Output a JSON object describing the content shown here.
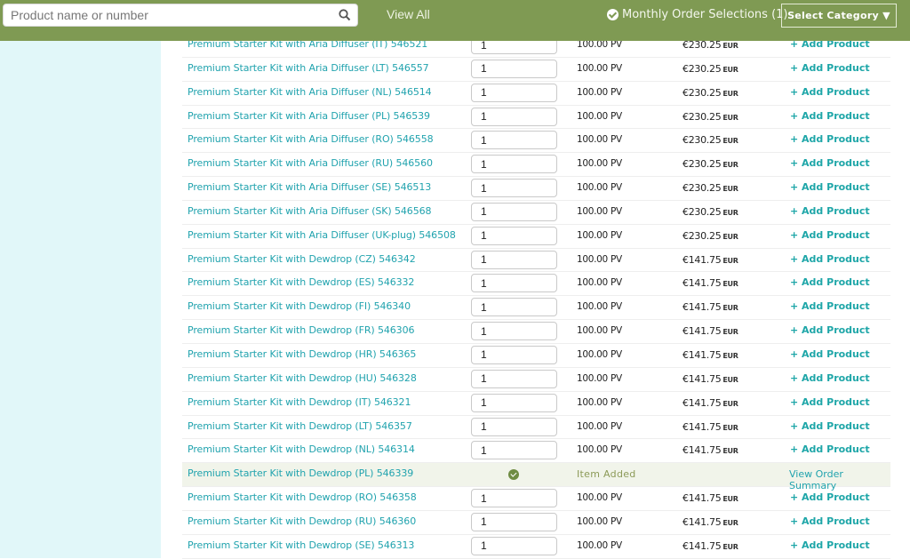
{
  "header": {
    "search_placeholder": "Product name or number",
    "search_value": "",
    "view_all": "View All",
    "monthly_order": "Monthly Order Selections (1)",
    "select_category": "Select Category ▼"
  },
  "colors": {
    "brand_green": "#7f9a53",
    "link_teal": "#21a3ae",
    "sidebar_bg": "#e1f7f9"
  },
  "rows": [
    {
      "name": "",
      "qty": "",
      "pv": "",
      "price": "",
      "currency": "",
      "action": "",
      "partial": true
    },
    {
      "name": "Premium Starter Kit with Aria Diffuser (IT) 546521",
      "qty": "1",
      "pv": "100.00 PV",
      "price": "€230.25",
      "currency": "EUR",
      "action": "+ Add Product"
    },
    {
      "name": "Premium Starter Kit with Aria Diffuser (LT) 546557",
      "qty": "1",
      "pv": "100.00 PV",
      "price": "€230.25",
      "currency": "EUR",
      "action": "+ Add Product"
    },
    {
      "name": "Premium Starter Kit with Aria Diffuser (NL) 546514",
      "qty": "1",
      "pv": "100.00 PV",
      "price": "€230.25",
      "currency": "EUR",
      "action": "+ Add Product"
    },
    {
      "name": "Premium Starter Kit with Aria Diffuser (PL) 546539",
      "qty": "1",
      "pv": "100.00 PV",
      "price": "€230.25",
      "currency": "EUR",
      "action": "+ Add Product"
    },
    {
      "name": "Premium Starter Kit with Aria Diffuser (RO) 546558",
      "qty": "1",
      "pv": "100.00 PV",
      "price": "€230.25",
      "currency": "EUR",
      "action": "+ Add Product"
    },
    {
      "name": "Premium Starter Kit with Aria Diffuser (RU) 546560",
      "qty": "1",
      "pv": "100.00 PV",
      "price": "€230.25",
      "currency": "EUR",
      "action": "+ Add Product"
    },
    {
      "name": "Premium Starter Kit with Aria Diffuser (SE) 546513",
      "qty": "1",
      "pv": "100.00 PV",
      "price": "€230.25",
      "currency": "EUR",
      "action": "+ Add Product"
    },
    {
      "name": "Premium Starter Kit with Aria Diffuser (SK) 546568",
      "qty": "1",
      "pv": "100.00 PV",
      "price": "€230.25",
      "currency": "EUR",
      "action": "+ Add Product"
    },
    {
      "name": "Premium Starter Kit with Aria Diffuser (UK-plug) 546508",
      "qty": "1",
      "pv": "100.00 PV",
      "price": "€230.25",
      "currency": "EUR",
      "action": "+ Add Product"
    },
    {
      "name": "Premium Starter Kit with Dewdrop (CZ) 546342",
      "qty": "1",
      "pv": "100.00 PV",
      "price": "€141.75",
      "currency": "EUR",
      "action": "+ Add Product"
    },
    {
      "name": "Premium Starter Kit with Dewdrop (ES) 546332",
      "qty": "1",
      "pv": "100.00 PV",
      "price": "€141.75",
      "currency": "EUR",
      "action": "+ Add Product"
    },
    {
      "name": "Premium Starter Kit with Dewdrop (FI) 546340",
      "qty": "1",
      "pv": "100.00 PV",
      "price": "€141.75",
      "currency": "EUR",
      "action": "+ Add Product"
    },
    {
      "name": "Premium Starter Kit with Dewdrop (FR) 546306",
      "qty": "1",
      "pv": "100.00 PV",
      "price": "€141.75",
      "currency": "EUR",
      "action": "+ Add Product"
    },
    {
      "name": "Premium Starter Kit with Dewdrop (HR) 546365",
      "qty": "1",
      "pv": "100.00 PV",
      "price": "€141.75",
      "currency": "EUR",
      "action": "+ Add Product"
    },
    {
      "name": "Premium Starter Kit with Dewdrop (HU) 546328",
      "qty": "1",
      "pv": "100.00 PV",
      "price": "€141.75",
      "currency": "EUR",
      "action": "+ Add Product"
    },
    {
      "name": "Premium Starter Kit with Dewdrop (IT) 546321",
      "qty": "1",
      "pv": "100.00 PV",
      "price": "€141.75",
      "currency": "EUR",
      "action": "+ Add Product"
    },
    {
      "name": "Premium Starter Kit with Dewdrop (LT) 546357",
      "qty": "1",
      "pv": "100.00 PV",
      "price": "€141.75",
      "currency": "EUR",
      "action": "+ Add Product"
    },
    {
      "name": "Premium Starter Kit with Dewdrop (NL) 546314",
      "qty": "1",
      "pv": "100.00 PV",
      "price": "€141.75",
      "currency": "EUR",
      "action": "+ Add Product"
    },
    {
      "name": "Premium Starter Kit with Dewdrop (PL) 546339",
      "added": true,
      "status": "Item Added",
      "action": "View Order Summary"
    },
    {
      "name": "Premium Starter Kit with Dewdrop (RO) 546358",
      "qty": "1",
      "pv": "100.00 PV",
      "price": "€141.75",
      "currency": "EUR",
      "action": "+ Add Product"
    },
    {
      "name": "Premium Starter Kit with Dewdrop (RU) 546360",
      "qty": "1",
      "pv": "100.00 PV",
      "price": "€141.75",
      "currency": "EUR",
      "action": "+ Add Product"
    },
    {
      "name": "Premium Starter Kit with Dewdrop (SE) 546313",
      "qty": "1",
      "pv": "100.00 PV",
      "price": "€141.75",
      "currency": "EUR",
      "action": "+ Add Product"
    }
  ]
}
